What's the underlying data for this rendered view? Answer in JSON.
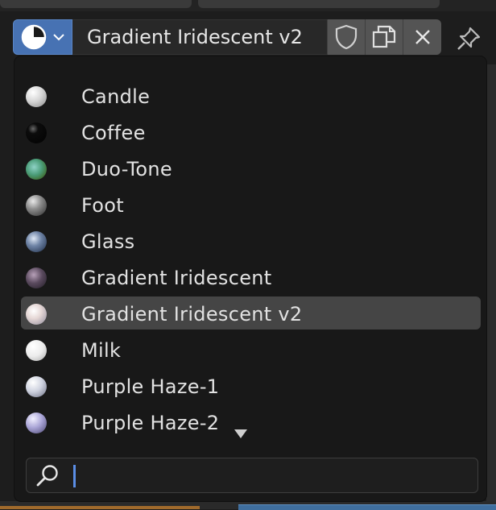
{
  "header": {
    "type_selector_icon": "matcap-sphere-icon",
    "name_value": "Gradient Iridescent v2",
    "fake_user_icon": "shield-icon",
    "duplicate_icon": "duplicate-icon",
    "unlink_icon": "close-icon",
    "pin_icon": "pin-icon"
  },
  "menu": {
    "items": [
      {
        "label": "Candle"
      },
      {
        "label": "Coffee"
      },
      {
        "label": "Duo-Tone"
      },
      {
        "label": "Foot"
      },
      {
        "label": "Glass"
      },
      {
        "label": "Gradient Iridescent"
      },
      {
        "label": "Gradient Iridescent v2",
        "active": true
      },
      {
        "label": "Milk"
      },
      {
        "label": "Purple Haze-1"
      },
      {
        "label": "Purple Haze-2"
      }
    ],
    "scroll_more_icon": "triangle-down-icon",
    "search": {
      "value": "",
      "icon": "search-icon"
    }
  },
  "colors": {
    "accent": "#4772b3",
    "highlight": "#454545",
    "caret": "#5b8ee6"
  }
}
